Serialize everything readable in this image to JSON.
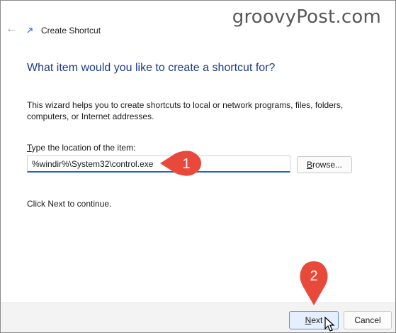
{
  "watermark": "groovyPost.com",
  "window": {
    "title": "Create Shortcut"
  },
  "wizard": {
    "heading": "What item would you like to create a shortcut for?",
    "description": "This wizard helps you to create shortcuts to local or network programs, files, folders, computers, or Internet addresses.",
    "location_label_mnemonic": "T",
    "location_label_rest": "ype the location of the item:",
    "location_value": "%windir%\\System32\\control.exe",
    "browse_label_mnemonic": "B",
    "browse_label_rest": "rowse...",
    "continue_text": "Click Next to continue."
  },
  "footer": {
    "next_label_mnemonic": "N",
    "next_label_rest": "ext",
    "cancel_label": "Cancel"
  },
  "annotations": {
    "step1": "1",
    "step2": "2",
    "badge_color": "#e8493a"
  },
  "icons": {
    "back": "back-arrow-icon",
    "app": "shortcut-icon",
    "cursor": "mouse-pointer-icon"
  }
}
